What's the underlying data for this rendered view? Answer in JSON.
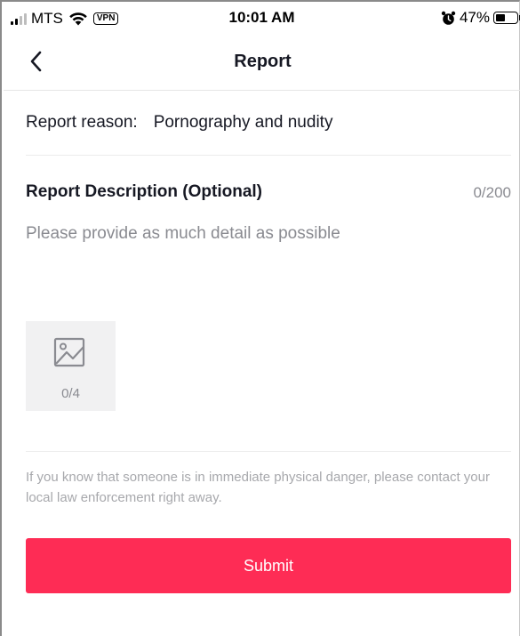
{
  "status_bar": {
    "carrier": "MTS",
    "vpn_label": "VPN",
    "time": "10:01 AM",
    "battery_percent": "47%",
    "battery_level": 0.47
  },
  "nav": {
    "title": "Report",
    "back_icon": "chevron-left-icon"
  },
  "reason": {
    "label": "Report reason:",
    "value": "Pornography and nudity"
  },
  "description": {
    "title": "Report Description (Optional)",
    "counter": "0/200",
    "value": "",
    "placeholder": "Please provide as much detail as possible"
  },
  "upload": {
    "icon": "image-icon",
    "counter": "0/4"
  },
  "disclaimer": "If you know that someone is in immediate physical danger, please contact your local law enforcement right away.",
  "submit_label": "Submit",
  "colors": {
    "accent": "#fe2c55",
    "secondary_text": "#8a8b91",
    "upload_bg": "#f1f1f2"
  }
}
